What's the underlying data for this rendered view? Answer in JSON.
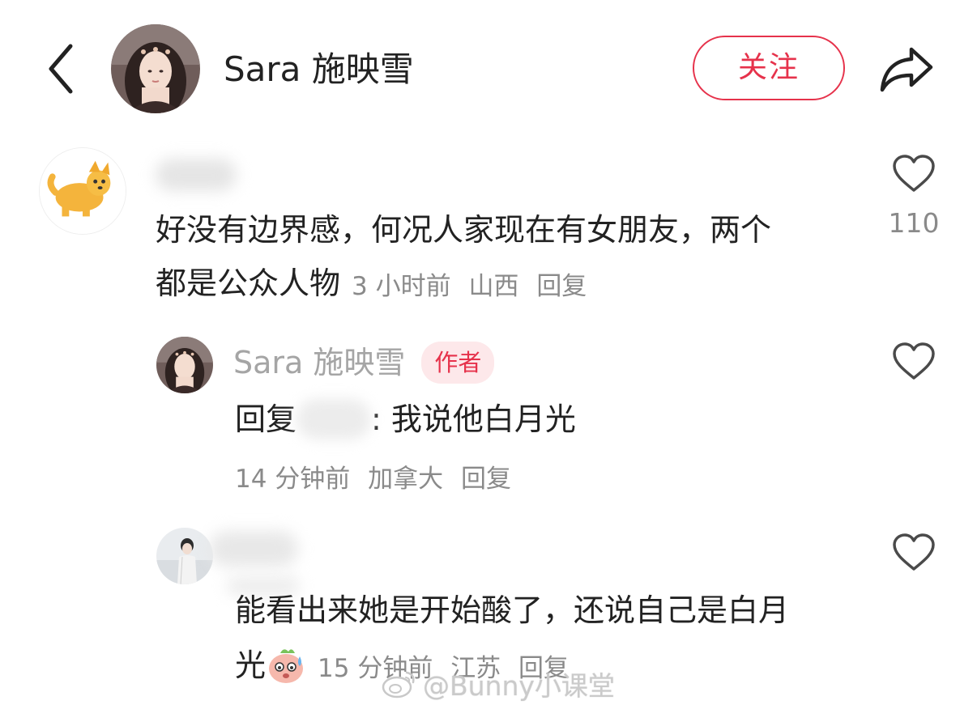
{
  "header": {
    "username": "Sara 施映雪",
    "follow_label": "关注"
  },
  "comments": [
    {
      "text_line1": "好没有边界感，何况人家现在有女朋友，两个",
      "text_line2": "都是公众人物",
      "time": "3 小时前",
      "location": "山西",
      "reply_label": "回复",
      "likes": "110"
    }
  ],
  "replies": [
    {
      "author": "Sara 施映雪",
      "author_tag": "作者",
      "reply_prefix": "回复",
      "text": ": 我说他白月光",
      "time": "14 分钟前",
      "location": "加拿大",
      "reply_label": "回复"
    },
    {
      "text_line1": "能看出来她是开始酸了，还说自己是白月",
      "text_line2": "光",
      "time": "15 分钟前",
      "location": "江苏",
      "reply_label": "回复"
    }
  ],
  "watermark": "@Bunny小课堂",
  "colors": {
    "accent": "#e6324b",
    "author_tag_bg": "#fde8ea",
    "meta_text": "#8a8a8a"
  },
  "icons": {
    "back": "chevron-left-icon",
    "share": "share-arrow-icon",
    "like": "heart-outline-icon",
    "emoji": "sweat-face-emoji-icon",
    "watermark_logo": "weibo-logo-icon"
  }
}
